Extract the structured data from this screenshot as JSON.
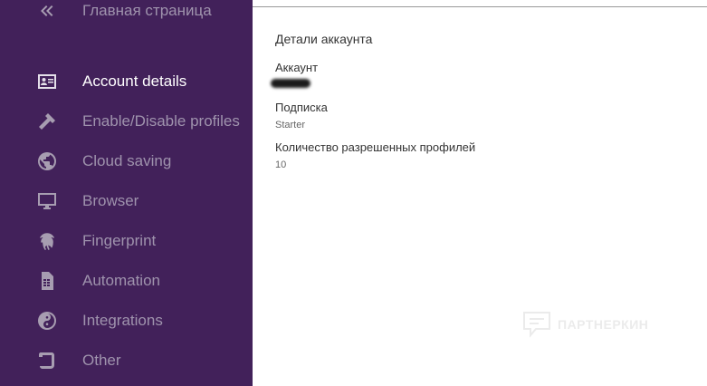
{
  "sidebar": {
    "home": {
      "label": "Главная страница",
      "icon": "double-chevron-left-icon"
    },
    "items": [
      {
        "label": "Account details",
        "icon": "account-card-icon",
        "active": true
      },
      {
        "label": "Enable/Disable profiles",
        "icon": "hammer-icon",
        "active": false
      },
      {
        "label": "Cloud saving",
        "icon": "globe-icon",
        "active": false
      },
      {
        "label": "Browser",
        "icon": "monitor-icon",
        "active": false
      },
      {
        "label": "Fingerprint",
        "icon": "fingerprint-icon",
        "active": false
      },
      {
        "label": "Automation",
        "icon": "sim-card-icon",
        "active": false
      },
      {
        "label": "Integrations",
        "icon": "yin-yang-icon",
        "active": false
      },
      {
        "label": "Other",
        "icon": "scroll-icon",
        "active": false
      }
    ]
  },
  "main": {
    "title": "Детали аккаунта",
    "account": {
      "label": "Аккаунт",
      "value": "(hidden)"
    },
    "subscription": {
      "label": "Подписка",
      "value": "Starter"
    },
    "profiles": {
      "label": "Количество разрешенных профилей",
      "value": "10"
    }
  },
  "watermark": {
    "text": "ПАРТНЕРКИН"
  },
  "colors": {
    "sidebar_bg": "#42215a",
    "active_text": "#ffffff",
    "inactive_text": "#9f93ad"
  }
}
